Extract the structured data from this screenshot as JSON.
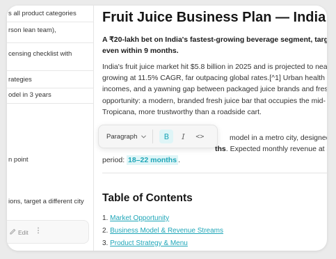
{
  "sidebar": {
    "rows": [
      "s all product categories",
      "rson lean team),",
      "censing checklist with",
      "rategies",
      "odel in 3 years",
      "n point",
      "ions, target a different city"
    ],
    "edit_label": "Edit",
    "more_glyph": "⋮"
  },
  "doc": {
    "title": "Fruit Juice Business Plan — India 2",
    "lead_line1": "A ₹20-lakh bet on India's fastest-growing beverage segment, targe",
    "lead_line2": "even within 9 months.",
    "para_lines": [
      "India's fruit juice market hit $5.8 billion in 2025 and is projected to nea",
      "growing at 11.5% CAGR, far outpacing global rates.[^1] Urban health co",
      "incomes, and a yawning gap between packaged juice brands and fresh",
      "opportunity: a modern, branded fresh juice bar that occupies the mid-",
      "Tropicana, more trustworthy than a roadside cart."
    ],
    "para2_visible": "model in a metro city, designed to pro",
    "para2_bold": "ths",
    "para2_tail": ". Expected monthly revenue at ste",
    "para3_prefix": "period: ",
    "para3_highlight": "18–22 months",
    "para3_suffix": ".",
    "toc_title": "Table of Contents",
    "toc": [
      {
        "num": "1.",
        "label": "Market Opportunity"
      },
      {
        "num": "2.",
        "label": "Business Model & Revenue Streams"
      },
      {
        "num": "3.",
        "label": "Product Strategy & Menu"
      }
    ]
  },
  "toolbar": {
    "block_type": "Paragraph",
    "bold_glyph": "B",
    "italic_glyph": "I",
    "code_glyph": "<>"
  },
  "colors": {
    "accent": "#1fa6b8",
    "accent_bg": "#dff5f7"
  }
}
